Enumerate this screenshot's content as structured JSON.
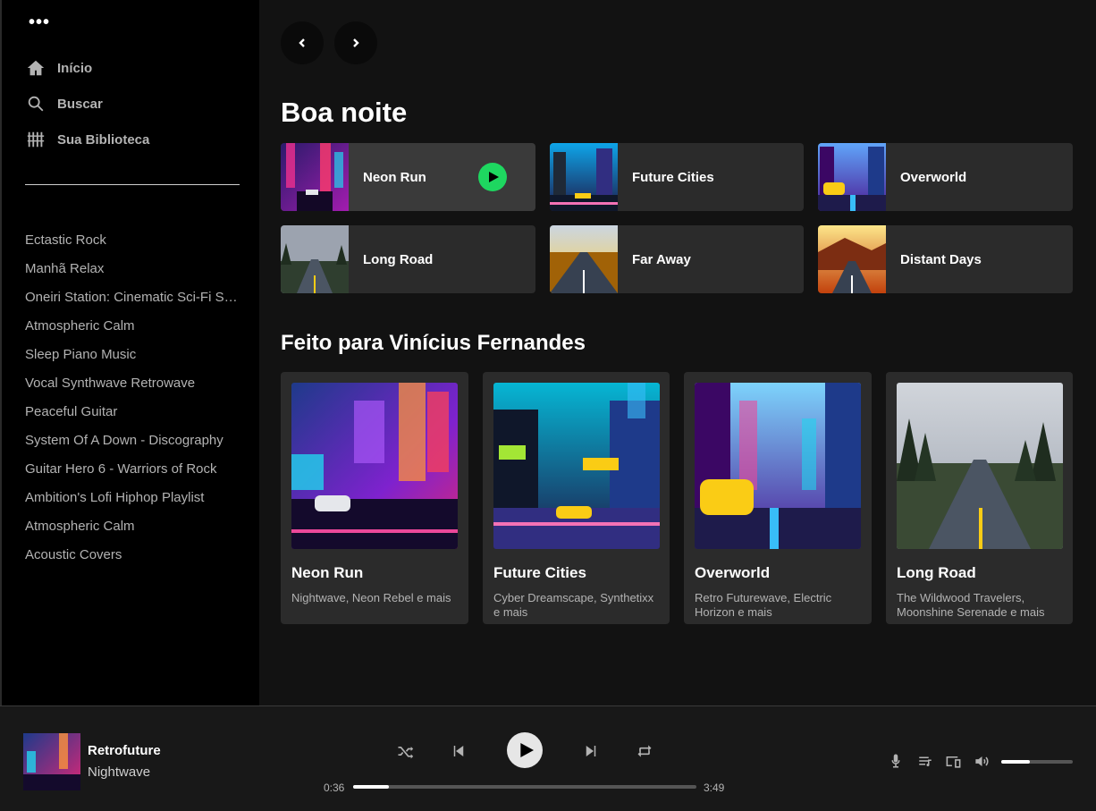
{
  "sidebar": {
    "menu_icon": "more-dots-icon",
    "nav": [
      {
        "label": "Início",
        "icon": "home-icon"
      },
      {
        "label": "Buscar",
        "icon": "search-icon"
      },
      {
        "label": "Sua Biblioteca",
        "icon": "library-icon"
      }
    ],
    "playlists": [
      "Ectastic Rock",
      "Manhã Relax",
      "Oneiri Station: Cinematic Sci-Fi Soundscapes",
      "Atmospheric Calm",
      "Sleep Piano Music",
      "Vocal Synthwave Retrowave",
      "Peaceful Guitar",
      "System Of A Down - Discography",
      "Guitar Hero 6 - Warriors of Rock",
      "Ambition's Lofi Hiphop Playlist",
      "Atmospheric Calm",
      "Acoustic Covers"
    ]
  },
  "main": {
    "greeting": "Boa noite",
    "quick": [
      {
        "title": "Neon Run",
        "art": "neon"
      },
      {
        "title": "Future Cities",
        "art": "city"
      },
      {
        "title": "Overworld",
        "art": "over"
      },
      {
        "title": "Long Road",
        "art": "road"
      },
      {
        "title": "Far Away",
        "art": "far"
      },
      {
        "title": "Distant Days",
        "art": "distant"
      }
    ],
    "made_for_heading": "Feito para Vinícius Fernandes",
    "cards": [
      {
        "title": "Neon Run",
        "subtitle": "Nightwave, Neon Rebel e mais"
      },
      {
        "title": "Future Cities",
        "subtitle": "Cyber Dreamscape, Synthetixx e mais"
      },
      {
        "title": "Overworld",
        "subtitle": "Retro Futurewave, Electric Horizon e mais"
      },
      {
        "title": "Long Road",
        "subtitle": "The Wildwood Travelers, Moonshine Serenade e mais"
      }
    ]
  },
  "player": {
    "track": "Retrofuture",
    "artist": "Nightwave",
    "elapsed": "0:36",
    "duration": "3:49",
    "progress_fraction": 0.103,
    "volume_fraction": 0.4,
    "colors": {
      "accent": "#1ed760",
      "background": "#121212"
    }
  }
}
